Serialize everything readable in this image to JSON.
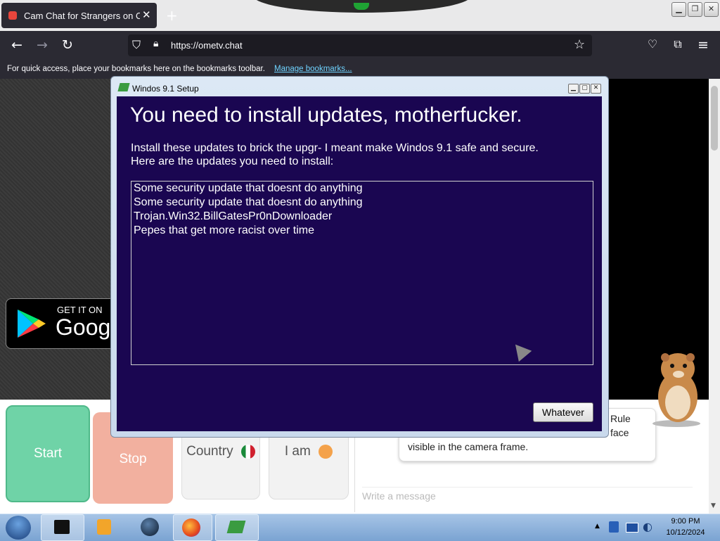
{
  "browser": {
    "tab_title": "Cam Chat for Strangers on Ome",
    "url": "https://ometv.chat",
    "bookmarks_text": "For quick access, place your bookmarks here on the bookmarks toolbar.",
    "bookmarks_link": "Manage bookmarks..."
  },
  "page": {
    "store_badge_top": "GET IT ON",
    "store_badge_name": "Googl",
    "start_label": "Start",
    "stop_label": "Stop",
    "country_label": "Country",
    "iam_label": "I am",
    "chat_notice": "Rule\nvisible in the camera frame.",
    "chat_notice_line1": "Rule",
    "chat_notice_line2": "face",
    "chat_notice_line3": "visible in the camera frame.",
    "message_placeholder": "Write a message"
  },
  "dialog": {
    "title": "Windos 9.1 Setup",
    "heading": "You need to install updates, motherfucker.",
    "description_line1": "Install these updates to brick the upgr- I meant make Windos 9.1 safe and secure.",
    "description_line2": "Here are the updates you need to install:",
    "updates": [
      "Some security update that doesnt do anything",
      "Some security update that doesnt do anything",
      "Trojan.Win32.BillGatesPr0nDownloader",
      "Pepes that get more racist over time"
    ],
    "button_label": "Whatever"
  },
  "taskbar": {
    "time": "9:00 PM",
    "date": "10/12/2024"
  },
  "colors": {
    "dialog_body": "#1a0651",
    "start": "#6fd3a7",
    "stop": "#f2b09f",
    "link": "#6fd3ff"
  }
}
